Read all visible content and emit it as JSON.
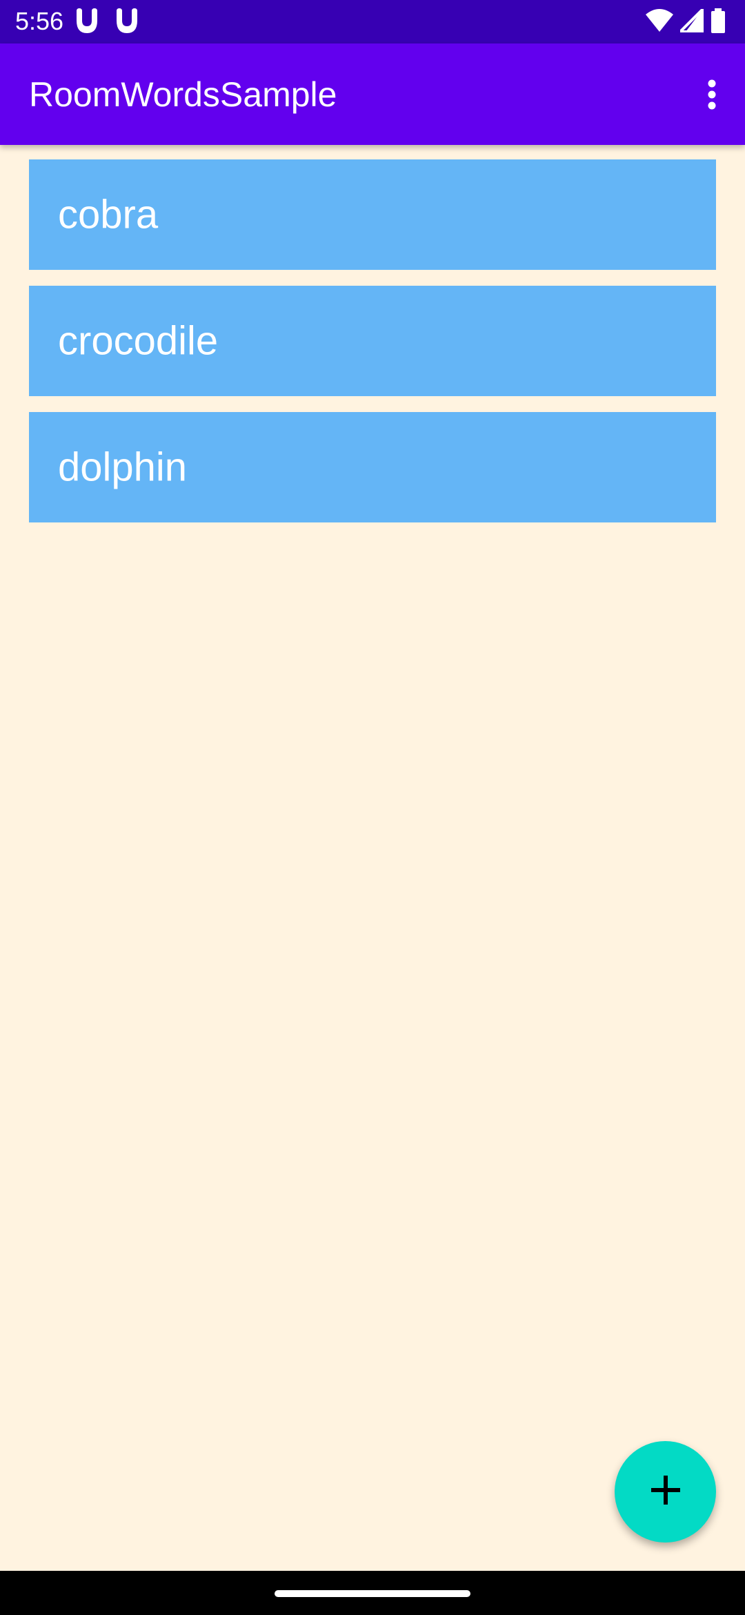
{
  "status_bar": {
    "time": "5:56",
    "notification_icons": [
      "app-notification-icon",
      "app-notification-icon"
    ],
    "right_icons": [
      "wifi-icon",
      "cellular-signal-icon",
      "battery-icon"
    ],
    "background": "#3700B3"
  },
  "app_bar": {
    "title": "RoomWordsSample",
    "background": "#6200EE",
    "menu_icon": "more-vert-icon"
  },
  "words": [
    {
      "label": "cobra"
    },
    {
      "label": "crocodile"
    },
    {
      "label": "dolphin"
    }
  ],
  "list_item_color": "#64B5F6",
  "background_color": "#FFF3E0",
  "fab": {
    "icon": "add-icon",
    "color": "#03DAC5"
  }
}
